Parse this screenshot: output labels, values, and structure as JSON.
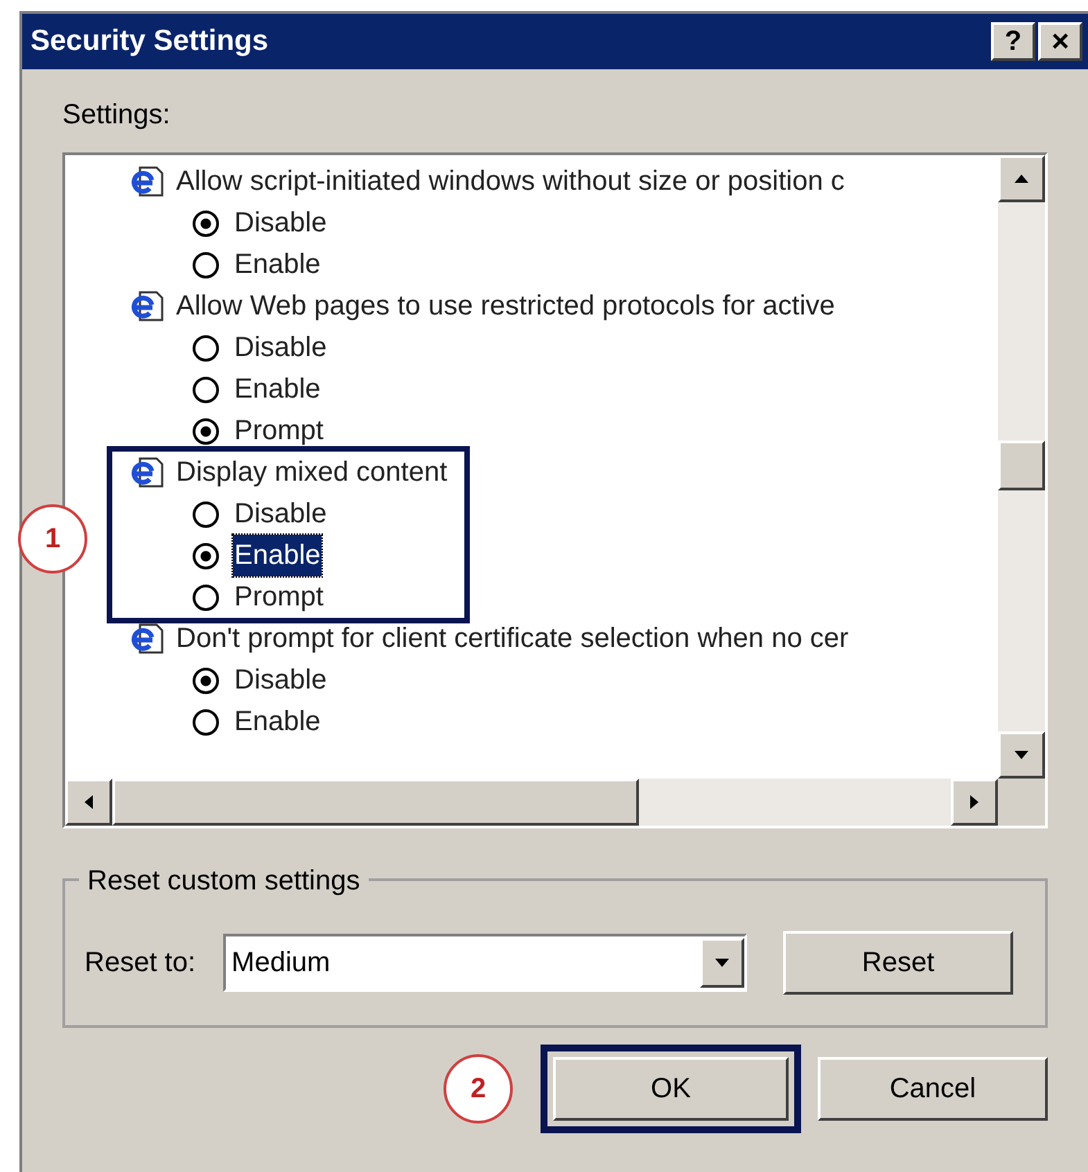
{
  "window": {
    "title": "Security Settings",
    "help_button": "?",
    "close_button": "×"
  },
  "settings_label": "Settings:",
  "settings": [
    {
      "label": "Allow script-initiated windows without size or position c",
      "options": [
        {
          "label": "Disable",
          "selected": true,
          "focused": false
        },
        {
          "label": "Enable",
          "selected": false,
          "focused": false
        }
      ]
    },
    {
      "label": "Allow Web pages to use restricted protocols for active",
      "options": [
        {
          "label": "Disable",
          "selected": false,
          "focused": false
        },
        {
          "label": "Enable",
          "selected": false,
          "focused": false
        },
        {
          "label": "Prompt",
          "selected": true,
          "focused": false
        }
      ]
    },
    {
      "label": "Display mixed content",
      "callout": "1",
      "options": [
        {
          "label": "Disable",
          "selected": false,
          "focused": false
        },
        {
          "label": "Enable",
          "selected": true,
          "focused": true
        },
        {
          "label": "Prompt",
          "selected": false,
          "focused": false
        }
      ]
    },
    {
      "label": "Don't prompt for client certificate selection when no cer",
      "options": [
        {
          "label": "Disable",
          "selected": true,
          "focused": false
        },
        {
          "label": "Enable",
          "selected": false,
          "focused": false
        }
      ]
    }
  ],
  "reset_group": {
    "title": "Reset custom settings",
    "label": "Reset to:",
    "value": "Medium",
    "button": "Reset"
  },
  "buttons": [
    {
      "label": "OK",
      "callout": "2"
    },
    {
      "label": "Cancel"
    }
  ]
}
